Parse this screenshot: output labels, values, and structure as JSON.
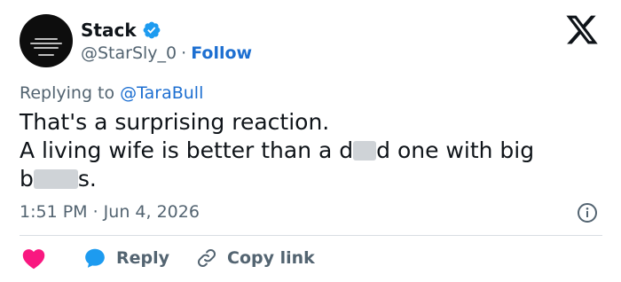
{
  "author": {
    "name": "Stack",
    "handle": "@StarSly_0",
    "separator": "·",
    "follow_label": "Follow",
    "verified": true,
    "avatar_icon": "profile-quote-avatar"
  },
  "reply_context": {
    "prefix": "Replying to",
    "mention": "@TaraBull"
  },
  "tweet": {
    "line1": "That's a surprising reaction.",
    "line2_before": "A living wife is better than a d",
    "line2_after": "d one with big",
    "line3_before": "b",
    "line3_after": "s."
  },
  "meta": {
    "timestamp": "1:51 PM · Jun 4, 2026"
  },
  "actions": {
    "like_icon": "heart-icon",
    "reply_label": "Reply",
    "copy_label": "Copy link"
  },
  "colors": {
    "accent": "#1d6fd1",
    "verified": "#1d9bf0",
    "heart": "#f91880",
    "secondary_text": "#536471",
    "censor": "#cfd3d7"
  }
}
